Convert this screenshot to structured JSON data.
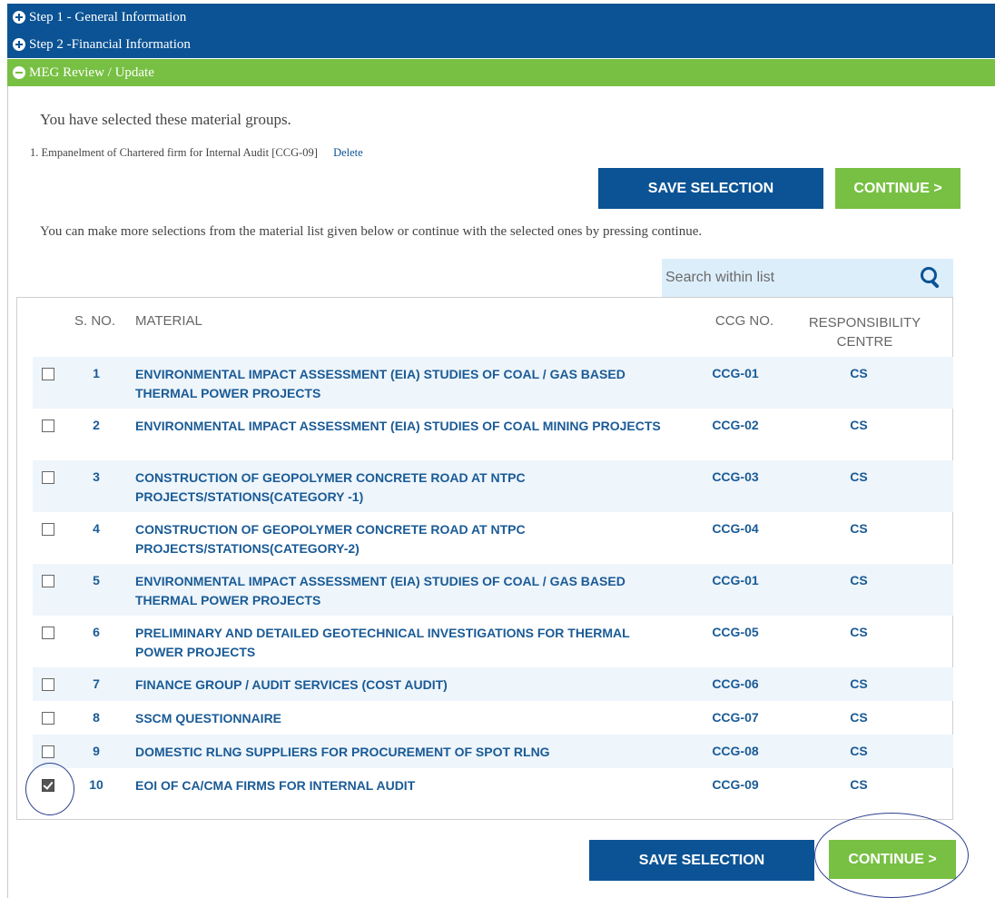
{
  "accordion": {
    "step1": "Step 1 - General Information",
    "step2": "Step 2 -Financial Information",
    "meg": "MEG Review / Update"
  },
  "review": {
    "intro": "You have selected these material groups.",
    "selected_item": "1. Empanelment of Chartered firm for Internal Audit [CCG-09]",
    "delete_label": "Delete",
    "hint": "You can make more selections from the material list given below or continue with the selected ones by pressing continue."
  },
  "buttons": {
    "save": "SAVE SELECTION",
    "continue": "CONTINUE >"
  },
  "search": {
    "placeholder": "Search within list"
  },
  "table": {
    "headers": {
      "sno": "S. NO.",
      "material": "MATERIAL",
      "ccg": "CCG NO.",
      "resp_line1": "RESPONSIBILITY",
      "resp_line2": "CENTRE"
    },
    "rows": [
      {
        "sno": "1",
        "material": "ENVIRONMENTAL IMPACT ASSESSMENT (EIA) STUDIES OF COAL / GAS BASED THERMAL POWER PROJECTS",
        "ccg": "CCG-01",
        "resp": "CS",
        "checked": false
      },
      {
        "sno": "2",
        "material": "ENVIRONMENTAL IMPACT ASSESSMENT (EIA) STUDIES OF COAL MINING PROJECTS",
        "ccg": "CCG-02",
        "resp": "CS",
        "checked": false
      },
      {
        "sno": "3",
        "material": "CONSTRUCTION OF GEOPOLYMER CONCRETE ROAD AT NTPC PROJECTS/STATIONS(CATEGORY -1)",
        "ccg": "CCG-03",
        "resp": "CS",
        "checked": false
      },
      {
        "sno": "4",
        "material": "CONSTRUCTION OF GEOPOLYMER CONCRETE ROAD AT NTPC PROJECTS/STATIONS(CATEGORY-2)",
        "ccg": "CCG-04",
        "resp": "CS",
        "checked": false
      },
      {
        "sno": "5",
        "material": "ENVIRONMENTAL IMPACT ASSESSMENT (EIA) STUDIES OF COAL / GAS BASED THERMAL POWER PROJECTS",
        "ccg": "CCG-01",
        "resp": "CS",
        "checked": false
      },
      {
        "sno": "6",
        "material": "PRELIMINARY AND DETAILED GEOTECHNICAL INVESTIGATIONS FOR THERMAL POWER PROJECTS",
        "ccg": "CCG-05",
        "resp": "CS",
        "checked": false
      },
      {
        "sno": "7",
        "material": "FINANCE GROUP / AUDIT SERVICES (COST AUDIT)",
        "ccg": "CCG-06",
        "resp": "CS",
        "checked": false
      },
      {
        "sno": "8",
        "material": "SSCM QUESTIONNAIRE",
        "ccg": "CCG-07",
        "resp": "CS",
        "checked": false
      },
      {
        "sno": "9",
        "material": "DOMESTIC RLNG SUPPLIERS FOR PROCUREMENT OF SPOT RLNG",
        "ccg": "CCG-08",
        "resp": "CS",
        "checked": false
      },
      {
        "sno": "10",
        "material": "EOI OF CA/CMA FIRMS FOR INTERNAL AUDIT",
        "ccg": "CCG-09",
        "resp": "CS",
        "checked": true
      }
    ]
  },
  "colors": {
    "primary_blue": "#0b5394",
    "accent_green": "#77c043",
    "link_text": "#1a5b96",
    "row_stripe": "#eef5fb"
  }
}
